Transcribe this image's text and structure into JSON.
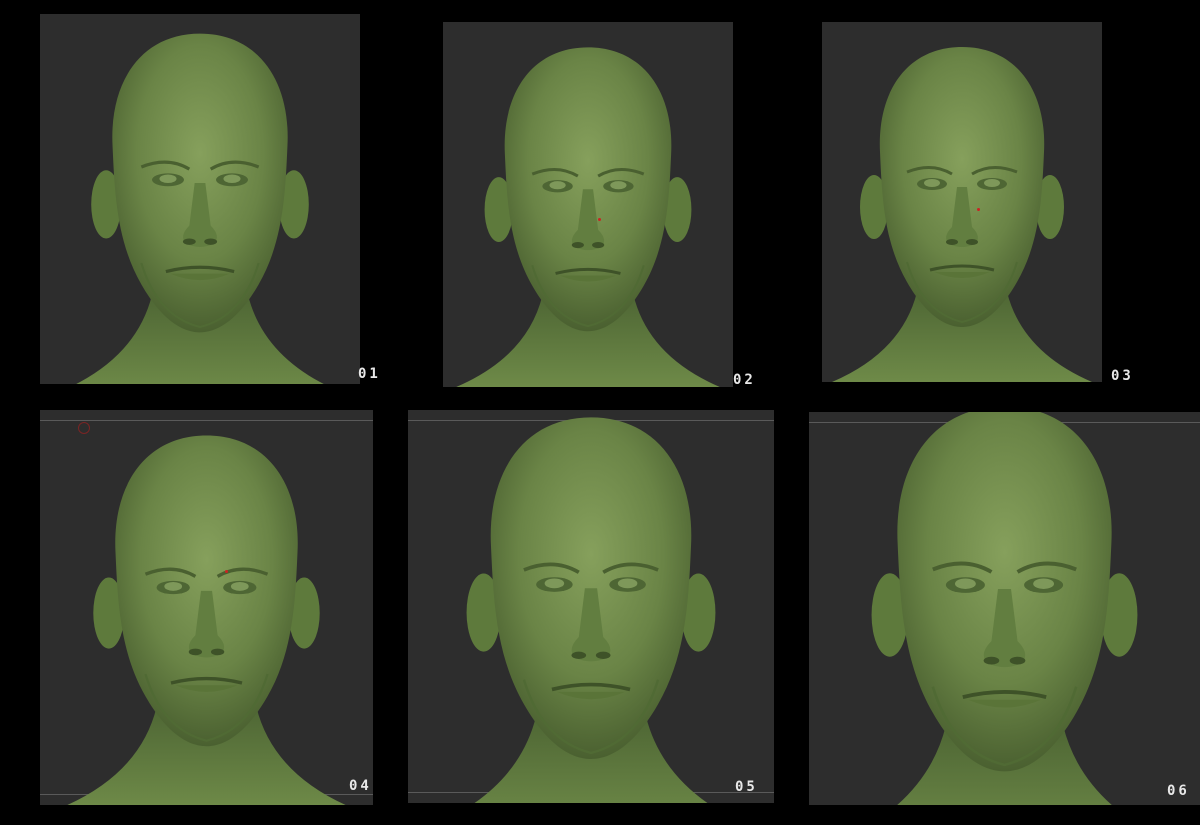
{
  "panels": [
    {
      "label": "01"
    },
    {
      "label": "02"
    },
    {
      "label": "03"
    },
    {
      "label": "04"
    },
    {
      "label": "05"
    },
    {
      "label": "06"
    }
  ],
  "colors": {
    "background": "#000000",
    "viewport": "#2d2d2d",
    "clay": "#6e8a48",
    "clay_dark": "#4a6030",
    "clay_light": "#8aa660",
    "label": "#e8e8e8"
  },
  "icons": [
    "head-sculpt-icon",
    "viewport-marker-icon"
  ]
}
